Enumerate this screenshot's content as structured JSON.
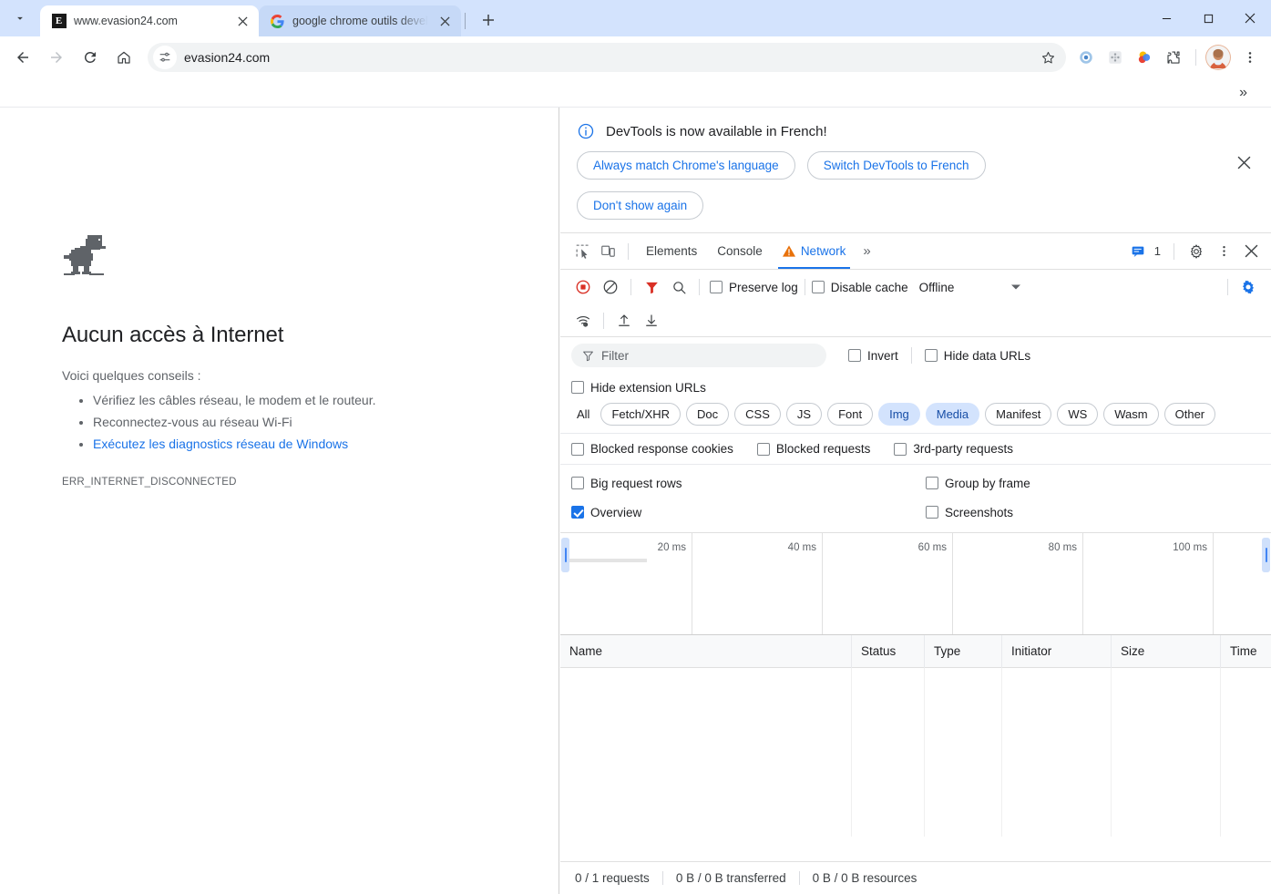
{
  "browser": {
    "tabs": [
      {
        "title": "www.evasion24.com",
        "favicon": "evasion-e-icon",
        "active": true
      },
      {
        "title": "google chrome outils developp",
        "favicon": "google-g-icon",
        "active": false
      }
    ],
    "new_tab_label": "+",
    "window_controls": {
      "minimize": "—",
      "maximize": "□",
      "close": "✕"
    },
    "nav": {
      "back": "back-arrow",
      "forward": "forward-arrow",
      "reload": "reload",
      "home": "home"
    },
    "omnibox": {
      "value": "evasion24.com",
      "site_settings_icon": "tune-icon"
    },
    "bookmark_star": "star-icon",
    "extensions": [
      "extension-blue-circle",
      "extension-grey-grid",
      "extension-color-circle",
      "extension-puzzle"
    ],
    "profile": "avatar",
    "menu": "three-dot-menu",
    "bookmarks_overflow": "»"
  },
  "error_page": {
    "icon": "dino-icon",
    "title": "Aucun accès à Internet",
    "subtitle": "Voici quelques conseils :",
    "tips": [
      {
        "text": "Vérifiez les câbles réseau, le modem et le routeur.",
        "link": false
      },
      {
        "text": "Reconnectez-vous au réseau Wi-Fi",
        "link": false
      },
      {
        "text": "Exécutez les diagnostics réseau de Windows",
        "link": true
      }
    ],
    "error_code": "ERR_INTERNET_DISCONNECTED"
  },
  "devtools": {
    "notice": {
      "icon": "info-icon",
      "message": "DevTools is now available in French!",
      "buttons": [
        "Always match Chrome's language",
        "Switch DevTools to French",
        "Don't show again"
      ],
      "close": "close-icon"
    },
    "tabbar": {
      "inspect_icon": "inspect-element-icon",
      "device_icon": "device-toolbar-icon",
      "tabs": [
        {
          "label": "Elements",
          "active": false,
          "warning": false
        },
        {
          "label": "Console",
          "active": false,
          "warning": false
        },
        {
          "label": "Network",
          "active": true,
          "warning": true
        }
      ],
      "more": "»",
      "issues_icon": "issues-icon",
      "issues_count": "1",
      "settings_icon": "gear-icon",
      "menu_icon": "three-dot-menu-icon",
      "close_icon": "close-icon"
    },
    "network_toolbar": {
      "record_icon": "record-stop-icon",
      "clear_icon": "clear-icon",
      "filter_icon": "filter-icon",
      "search_icon": "search-icon",
      "preserve_log": {
        "label": "Preserve log",
        "checked": false
      },
      "disable_cache": {
        "label": "Disable cache",
        "checked": false
      },
      "throttling": {
        "value": "Offline",
        "caret": "▼"
      },
      "settings_icon": "gear-icon-active",
      "network_conditions_icon": "wifi-settings-icon",
      "import_icon": "import-har-icon",
      "export_icon": "export-har-icon"
    },
    "filters": {
      "input_placeholder": "Filter",
      "input_icon": "filter-funnel-icon",
      "invert": {
        "label": "Invert",
        "checked": false
      },
      "hide_data_urls": {
        "label": "Hide data URLs",
        "checked": false
      },
      "hide_extension_urls": {
        "label": "Hide extension URLs",
        "checked": false
      },
      "types": [
        {
          "label": "All",
          "selected": false,
          "plain": true
        },
        {
          "label": "Fetch/XHR",
          "selected": false
        },
        {
          "label": "Doc",
          "selected": false
        },
        {
          "label": "CSS",
          "selected": false
        },
        {
          "label": "JS",
          "selected": false
        },
        {
          "label": "Font",
          "selected": false
        },
        {
          "label": "Img",
          "selected": true
        },
        {
          "label": "Media",
          "selected": true
        },
        {
          "label": "Manifest",
          "selected": false
        },
        {
          "label": "WS",
          "selected": false
        },
        {
          "label": "Wasm",
          "selected": false
        },
        {
          "label": "Other",
          "selected": false
        }
      ],
      "extra": [
        {
          "label": "Blocked response cookies",
          "checked": false
        },
        {
          "label": "Blocked requests",
          "checked": false
        },
        {
          "label": "3rd-party requests",
          "checked": false
        }
      ],
      "display": [
        {
          "label": "Big request rows",
          "checked": false
        },
        {
          "label": "Group by frame",
          "checked": false
        },
        {
          "label": "Overview",
          "checked": true
        },
        {
          "label": "Screenshots",
          "checked": false
        }
      ]
    },
    "overview": {
      "ticks": [
        "20 ms",
        "40 ms",
        "60 ms",
        "80 ms",
        "100 ms"
      ]
    },
    "table": {
      "columns": [
        "Name",
        "Status",
        "Type",
        "Initiator",
        "Size",
        "Time"
      ],
      "rows": []
    },
    "statusbar": [
      "0 / 1 requests",
      "0 B / 0 B transferred",
      "0 B / 0 B resources"
    ]
  }
}
